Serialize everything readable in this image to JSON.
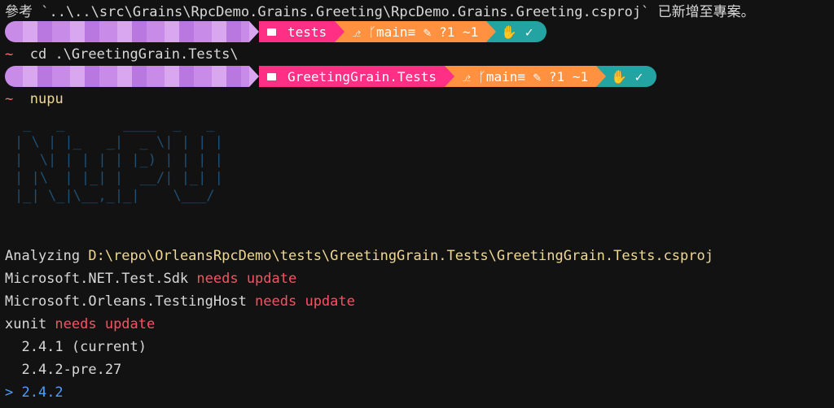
{
  "line0": {
    "text": "參考 `..\\..\\src\\Grains\\RpcDemo.Grains.Greeting\\RpcDemo.Grains.Greeting.csproj` 已新增至專案。"
  },
  "prompt1": {
    "folder_icon": "folder-icon",
    "dir": "tests",
    "git": "⎇ ᚴmain≡ ✎ ?1 ~1",
    "status": "✋ ✓"
  },
  "cmd1": {
    "tilde": "~",
    "text": "cd .\\GreetingGrain.Tests\\"
  },
  "prompt2": {
    "dir": "GreetingGrain.Tests",
    "git": "⎇ ᚴmain≡ ✎ ?1 ~1",
    "status": "✋ ✓"
  },
  "cmd2": {
    "tilde": "~",
    "text": "nupu"
  },
  "banner": " _   _       ____  _   _ \n| \\ | |_   _|  _ \\| | | |\n|  \\| | | | | |_) | | | |\n| |\\  | |_| |  __/| |_| |\n|_| \\_|\\__,_|_|    \\___/ ",
  "output": {
    "analyzing_label": "Analyzing ",
    "analyzing_path": "D:\\repo\\OrleansRpcDemo\\tests\\GreetingGrain.Tests\\GreetingGrain.Tests.csproj",
    "pkg1": "Microsoft.NET.Test.Sdk ",
    "pkg2": "Microsoft.Orleans.TestingHost ",
    "pkg3": "xunit ",
    "needs_update": "needs update",
    "opt1": "  2.4.1 (current)",
    "opt2": "  2.4.2-pre.27",
    "selected_marker": "> ",
    "selected": "2.4.2"
  },
  "colors": {
    "pink": "#ff2f86",
    "orange": "#ff9140",
    "teal": "#24a3a3",
    "purple": "#c98be8"
  }
}
